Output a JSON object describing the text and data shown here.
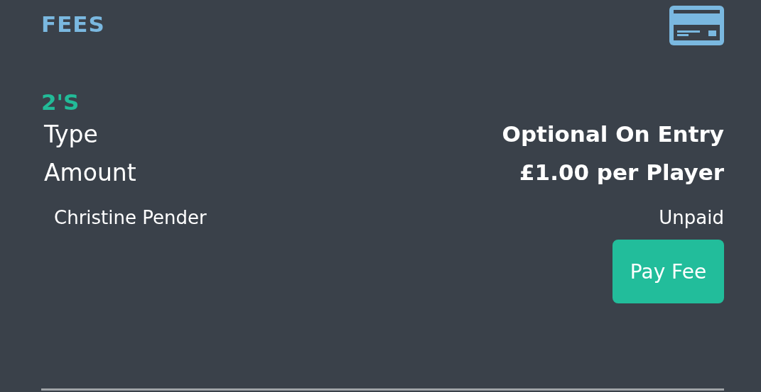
{
  "section": {
    "title": "FEES"
  },
  "fee": {
    "name": "2'S",
    "details": [
      {
        "label": "Type",
        "value": "Optional On Entry"
      },
      {
        "label": "Amount",
        "value": "£1.00 per Player"
      }
    ],
    "player": {
      "name": "Christine Pender",
      "status": "Unpaid"
    },
    "button": "Pay Fee"
  }
}
